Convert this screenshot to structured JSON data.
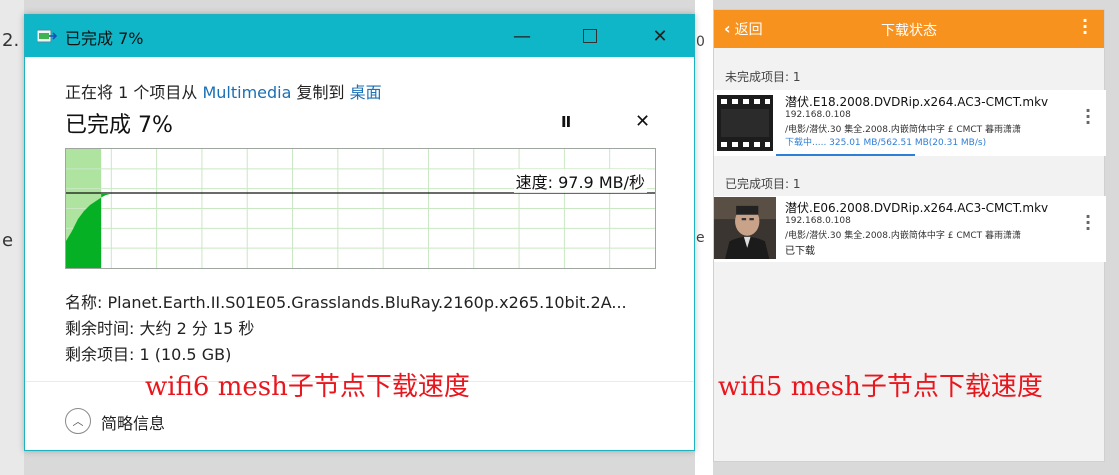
{
  "background": {
    "left_fragments": [
      "2.",
      "e"
    ],
    "gap_fragments": [
      "0",
      "e"
    ]
  },
  "copy_dialog": {
    "title": "已完成 7%",
    "buttons": {
      "minimize": "—",
      "close": "✕"
    },
    "copy_prefix": "正在将 1 个项目从 ",
    "source": "Multimedia",
    "copy_middle": " 复制到 ",
    "destination": "桌面",
    "progress_title": "已完成 7%",
    "progress_percent": 7,
    "pause_glyph": "II",
    "stop_glyph": "✕",
    "speed_label": "速度: 97.9 MB/秒",
    "name_row": "名称:  Planet.Earth.II.S01E05.Grasslands.BluRay.2160p.x265.10bit.2A...",
    "time_row": "剩余时间:  大约 2 分 15 秒",
    "items_row": "剩余项目:  1 (10.5 GB)",
    "details_label": "简略信息",
    "colors": {
      "titlebar": "#0fb6c8",
      "graph_fill": "#06b025",
      "graph_done": "#aee3a0",
      "link": "#1a6fb5"
    }
  },
  "captions": {
    "left": "wifi6 mesh子节点下载速度",
    "right": "wifi5 mesh子节点下载速度",
    "color": "#e8161d"
  },
  "mobile": {
    "back_label": "返回",
    "title": "下载状态",
    "incomplete_header": "未完成项目:  1",
    "complete_header": "已完成项目:  1",
    "items": [
      {
        "name": "潜伏.E18.2008.DVDRip.x264.AC3-CMCT.mkv",
        "ip": "192.168.0.108",
        "path": "/电影/潜伏.30 集全.2008.内嵌简体中字 £ CMCT 暮雨潇潇",
        "status": "下载中.....  325.01 MB/562.51 MB(20.31 MB/s)",
        "progress": 0.578,
        "thumb_icon": "film-icon"
      },
      {
        "name": "潜伏.E06.2008.DVDRip.x264.AC3-CMCT.mkv",
        "ip": "192.168.0.108",
        "path": "/电影/潜伏.30 集全.2008.内嵌简体中字 £ CMCT 暮雨潇潇",
        "status": "已下载",
        "thumb_icon": "video-thumbnail"
      }
    ],
    "colors": {
      "appbar": "#f7921e",
      "progress": "#2e7fd8"
    }
  }
}
